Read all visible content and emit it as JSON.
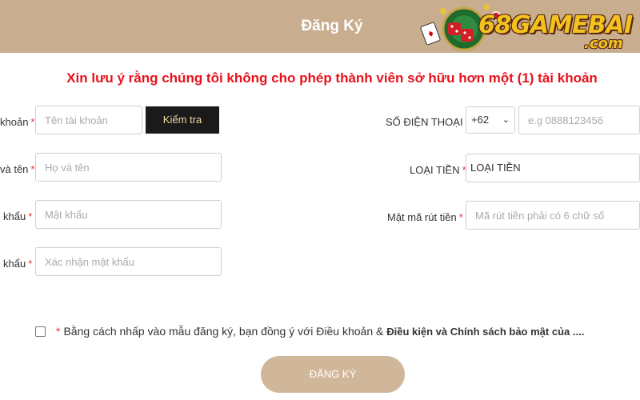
{
  "header": {
    "title": "Đăng Ký",
    "logo_text": "68GAMEBAI",
    "logo_domain": ".com"
  },
  "notice": "Xin lưu ý rằng chúng tôi không cho phép thành viên sở hữu hơn một (1) tài khoản",
  "form": {
    "left": {
      "username_label": "khoản",
      "username_placeholder": "Tên tài khoản",
      "check_button": "Kiểm tra",
      "fullname_label": "và tên",
      "fullname_placeholder": "Họ và tên",
      "password_label": "khẩu",
      "password_placeholder": "Mật khẩu",
      "confirm_label": "khẩu",
      "confirm_placeholder": "Xác nhận mật khẩu"
    },
    "right": {
      "phone_label": "SỐ ĐIỆN THOẠI",
      "country_code": "+62",
      "phone_placeholder": "e.g 0888123456",
      "currency_label": "LOẠI TIỀN",
      "currency_value": "LOẠI TIỀN",
      "withdraw_label": "Mật mã rút tiền",
      "withdraw_placeholder": "Mã rút tiền phải có 6 chữ số"
    },
    "required_mark": "*"
  },
  "terms": {
    "required_mark": "*",
    "text": "Bằng cách nhấp vào mẫu đăng ký, bạn đồng ý với Điều khoản & ",
    "bold_text": "Điều kiện và Chính sách bảo mật của ....",
    "checked": false
  },
  "submit_label": "ĐĂNG KÝ",
  "colors": {
    "header_bg": "#c8ad8e",
    "notice": "#e8111b",
    "submit_bg": "#d1b79a",
    "check_button_bg": "#1a1a1a",
    "logo_gold": "#f4c21e"
  }
}
